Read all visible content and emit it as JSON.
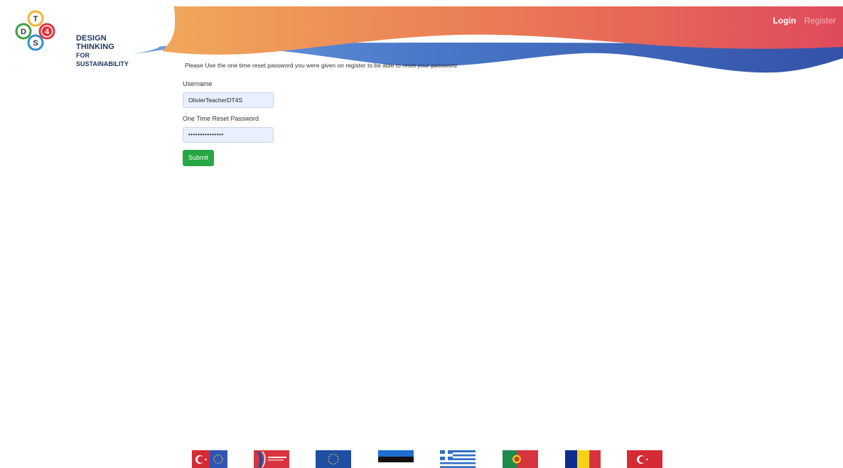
{
  "header": {
    "logo_letters": [
      "T",
      "4",
      "S",
      "D"
    ],
    "logo_line1": "DESIGN THINKING",
    "logo_line2": "FOR SUSTAINABILITY",
    "nav": {
      "login": "Login",
      "register": "Register"
    }
  },
  "main": {
    "notice": "Please Use the one time reset password you were given on register to be able to reset your password.",
    "username_label": "Username",
    "username_value": "OlivierTeacherDT4S",
    "password_label": "One Time Reset Password",
    "password_value": "•••••••••••••••",
    "submit_label": "Submit"
  },
  "footer": {
    "flags": [
      "turkey-flag",
      "turkish-national-agency-logo",
      "eu-flag",
      "estonia-flag",
      "greece-flag",
      "portugal-flag",
      "romania-flag",
      "turkey-flag"
    ]
  },
  "colors": {
    "wave_orange": "#f0a25a",
    "wave_red": "#e04a5c",
    "wave_blue": "#3b5bb0",
    "accent_green": "#28a745",
    "input_bg": "#e8f0fe"
  }
}
